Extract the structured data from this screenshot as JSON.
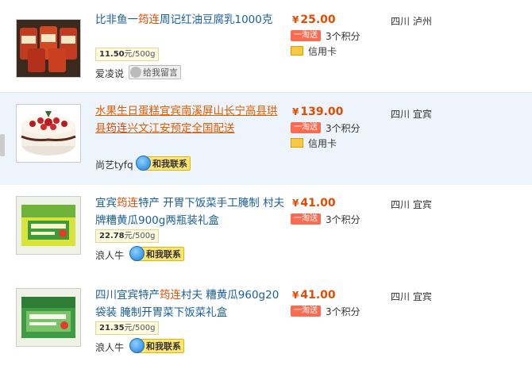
{
  "items": [
    {
      "title_prefix": "比非鱼一",
      "title_highlight": "筠连",
      "title_suffix": "周记红油豆腐乳1000克",
      "unit_price": "11.50",
      "unit_label": "元/500g",
      "seller": "爱凌说",
      "contact_label": "给我留言",
      "currency": "¥",
      "price": "25.00",
      "taobao_label": "一淘送",
      "points": "3个积分",
      "credit_card": "信用卡",
      "location": "四川 泸州"
    },
    {
      "title_prefix": "水果生日蛋糕宜宾南溪屏山长宁高县珙县",
      "title_highlight": "筠连",
      "title_suffix": "兴文江安预定全国配送",
      "unit_price": "",
      "unit_label": "",
      "seller": "尚艺tyfq",
      "contact_label": "和我联系",
      "currency": "¥",
      "price": "139.00",
      "taobao_label": "一淘送",
      "points": "3个积分",
      "credit_card": "信用卡",
      "location": "四川 宜宾"
    },
    {
      "title_prefix": "宜宾",
      "title_highlight": "筠连",
      "title_suffix": "特产 开胃下饭菜手工腌制 村夫牌糟黄瓜900g两瓶装礼盒",
      "unit_price": "22.78",
      "unit_label": "元/500g",
      "seller": "浪人牛",
      "contact_label": "和我联系",
      "currency": "¥",
      "price": "41.00",
      "taobao_label": "一淘送",
      "points": "3个积分",
      "credit_card": "",
      "location": "四川 宜宾"
    },
    {
      "title_prefix": "四川宜宾特产",
      "title_highlight": "筠连",
      "title_suffix": "村夫 糟黄瓜960g20袋装 腌制开胃菜下饭菜礼盒",
      "unit_price": "21.35",
      "unit_label": "元/500g",
      "seller": "浪人牛",
      "contact_label": "和我联系",
      "currency": "¥",
      "price": "41.00",
      "taobao_label": "一淘送",
      "points": "3个积分",
      "credit_card": "",
      "location": "四川 宜宾"
    }
  ],
  "colors": {
    "link": "#1a5f99",
    "highlight": "#e34b00",
    "price": "#e34b00",
    "taobao_badge": "#fc6a4f"
  },
  "icons": {
    "message": "speech-bubble-icon",
    "chat": "wangwang-icon",
    "card": "credit-card-icon"
  }
}
